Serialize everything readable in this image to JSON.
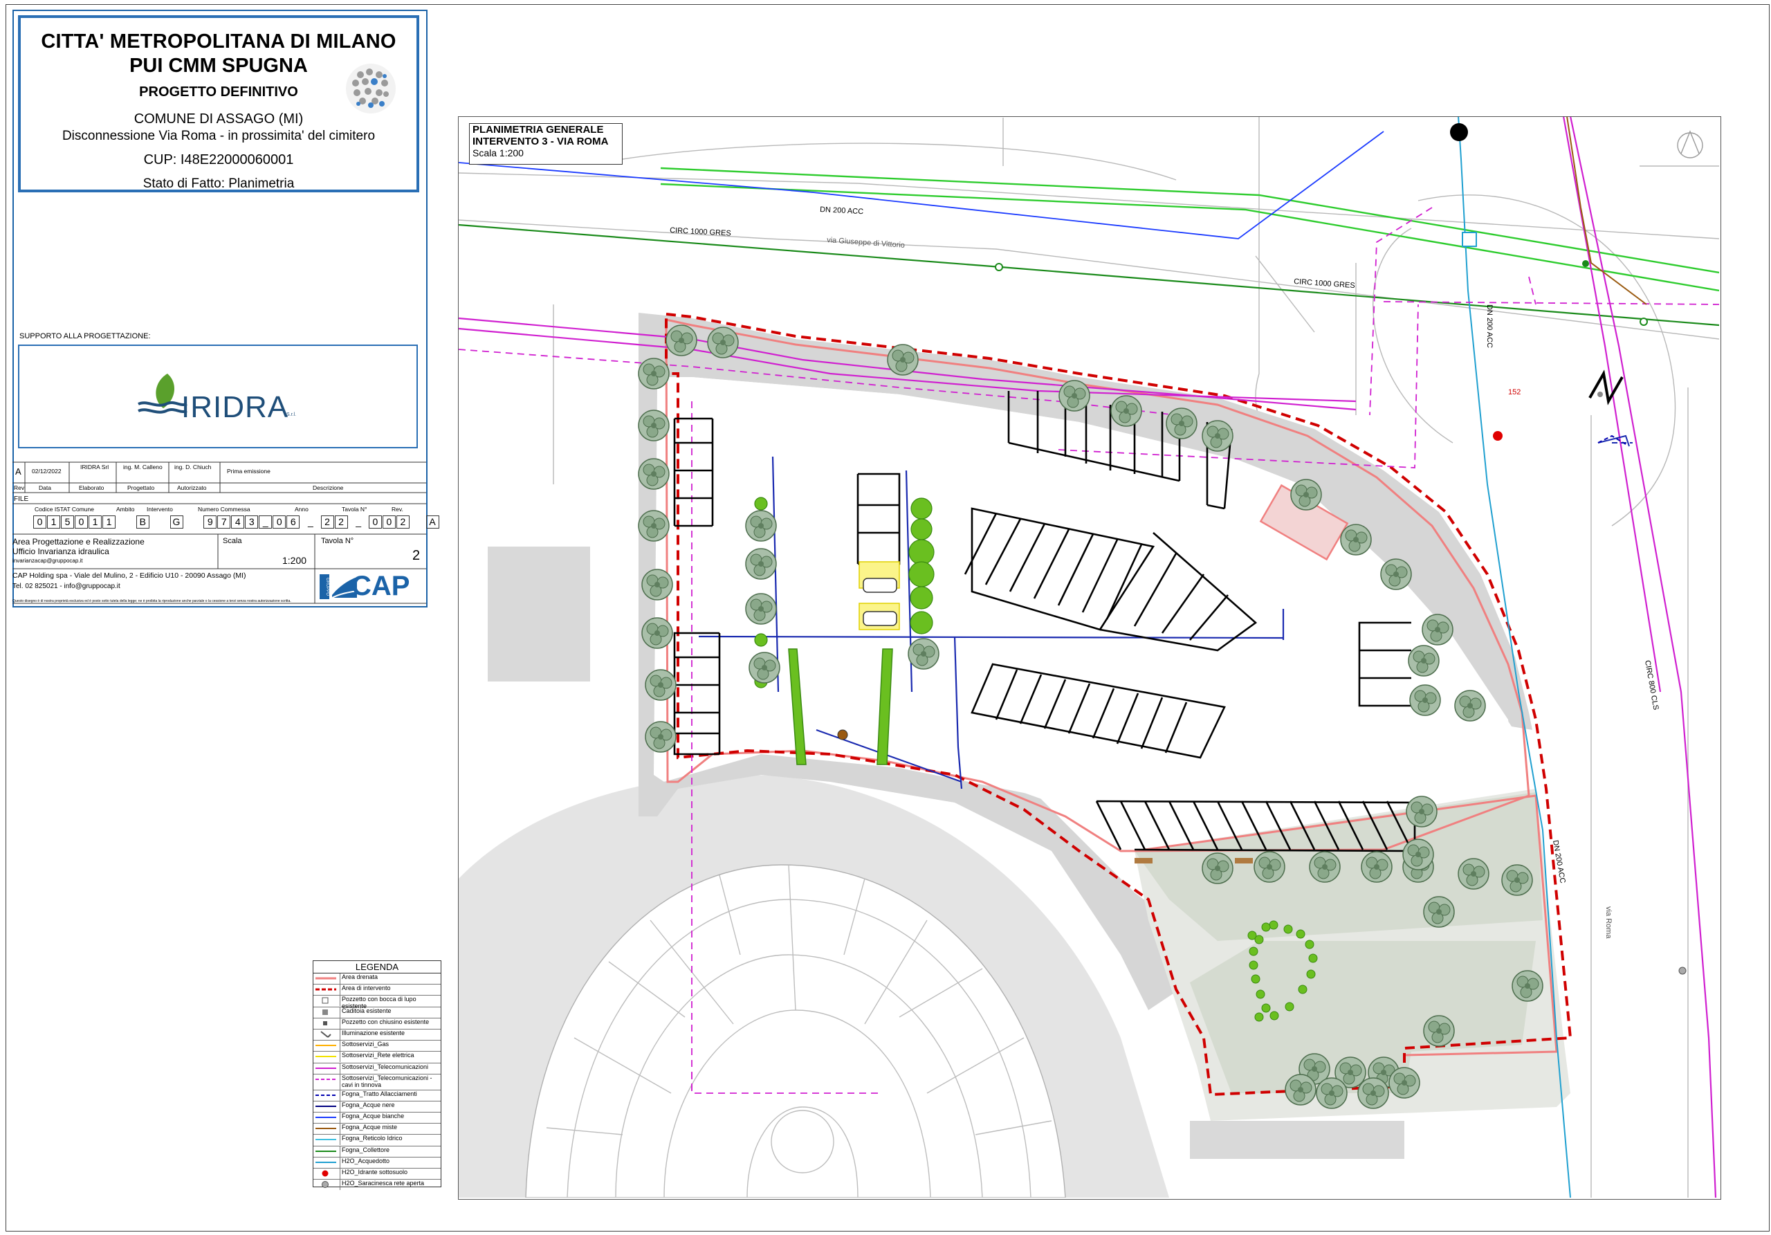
{
  "header": {
    "line1": "CITTA' METROPOLITANA DI MILANO",
    "line2": "PUI CMM SPUGNA",
    "line3": "PROGETTO DEFINITIVO",
    "line4": "COMUNE DI ASSAGO (MI)",
    "line5": "Disconnessione Via Roma - in prossimita' del cimitero",
    "line6": "CUP: I48E22000060001",
    "line7": "Stato di Fatto: Planimetria"
  },
  "support": {
    "label": "SUPPORTO ALLA PROGETTAZIONE:",
    "logo_text": "IRIDRA",
    "logo_suffix": "S.r.l."
  },
  "revision": {
    "rev": "A",
    "date": "02/12/2022",
    "elaborated": "IRIDRA Srl",
    "designed": "ing. M. Calleno",
    "authorized": "ing. D. Chiuch",
    "description": "Prima emissione",
    "headers": [
      "Rev",
      "Data",
      "Elaborato",
      "Progettato",
      "Autorizzato",
      "Descrizione"
    ]
  },
  "file": {
    "label": "FILE",
    "fields": [
      "Codice ISTAT Comune",
      "Ambito",
      "Intervento",
      "Numero Commessa",
      "Anno",
      "Tavola N°",
      "Rev."
    ],
    "istat": [
      "0",
      "1",
      "5",
      "0",
      "1",
      "1"
    ],
    "ambito": "B",
    "intervento": "G",
    "commessa": [
      "9",
      "7",
      "4",
      "3",
      "_",
      "0",
      "6"
    ],
    "anno": [
      "2",
      "2"
    ],
    "tavola": [
      "0",
      "0",
      "2"
    ],
    "rev": "A",
    "sep": "_"
  },
  "office": {
    "line1": "Area Progettazione e Realizzazione",
    "line2": "Ufficio Invarianza idraulica",
    "email": "invarianzacap@gruppocap.it",
    "scala_label": "Scala",
    "scala": "1:200",
    "tavola_label": "Tavola N°",
    "tavola": "2",
    "company": "CAP Holding spa - Viale del Mulino, 2 - Edificio U10 - 20090 Assago (MI)",
    "contacts": "Tel. 02 825021 - info@gruppocap.it",
    "disclaimer": "Questo disegno è di nostra proprietà esclusiva ed è posto sotto tutela della legge; ne è proibita la riproduzione anche parziale o la cessione a terzi senza nostra autorizzazione scritta.",
    "logo": "CAP",
    "logo_small": "GRUPPO"
  },
  "plan_title": {
    "line1": "PLANIMETRIA GENERALE",
    "line2": "INTERVENTO 3 - VIA ROMA",
    "line3": "Scala 1:200"
  },
  "map_labels": {
    "dn200_top": "DN 200 ACC",
    "circ1000_left": "CIRC 1000 GRES",
    "via_vittorio": "via Giuseppe di Vittorio",
    "circ1000_right": "CIRC 1000 GRES",
    "dn200_vertical": "DN 200 ACC",
    "num152": "152",
    "circ800": "CIRC 800 CLS",
    "dn200_lower": "DN 200 ACC",
    "via_roma": "via Roma",
    "north": "N"
  },
  "legend": {
    "title": "LEGENDA",
    "items": [
      {
        "label": "Area drenata",
        "color": "#f08080"
      },
      {
        "label": "Area di intervento",
        "color": "#d00000"
      },
      {
        "label": "Pozzetto con bocca di lupo esistente",
        "color": "#555555"
      },
      {
        "label": "Caditoia esistente",
        "color": "#555555"
      },
      {
        "label": "Pozzetto con chiusino esistente",
        "color": "#555555"
      },
      {
        "label": "Illuminazione esistente",
        "color": "#555555"
      },
      {
        "label": "Sottoservizi_Gas",
        "color": "#ffb000"
      },
      {
        "label": "Sottoservizi_Rete elettrica",
        "color": "#f2e200"
      },
      {
        "label": "Sottoservizi_Telecomunicazioni",
        "color": "#d020d0"
      },
      {
        "label": "Sottoservizi_Telecomunicazioni - cavi in tinnova",
        "color": "#d020d0"
      },
      {
        "label": "Fogna_Tratto Allacciamenti",
        "color": "#0000b0"
      },
      {
        "label": "Fogna_Acque nere",
        "color": "#000080"
      },
      {
        "label": "Fogna_Acque bianche",
        "color": "#1a3aff"
      },
      {
        "label": "Fogna_Acque miste",
        "color": "#9a5a10"
      },
      {
        "label": "Fogna_Reticolo Idrico",
        "color": "#40c0e0"
      },
      {
        "label": "Fogna_Collettore",
        "color": "#1a8a1a"
      },
      {
        "label": "H2O_Acquedotto",
        "color": "#20a0d0"
      },
      {
        "label": "H2O_Idrante sottosuolo",
        "color": "#e00000"
      },
      {
        "label": "H2O_Saracinesca rete aperta",
        "color": "#888888"
      }
    ]
  },
  "colors": {
    "frame_blue": "#2a6fb5",
    "drained_area": "#f08080",
    "intervention": "#d00000",
    "gas_green": "#2ecc2e",
    "telecom": "#d020d0",
    "water_blue": "#20a0d0",
    "sewer": "#1a3aff",
    "pavement": "#d9d9d9",
    "trees": "#7a9a7a"
  }
}
